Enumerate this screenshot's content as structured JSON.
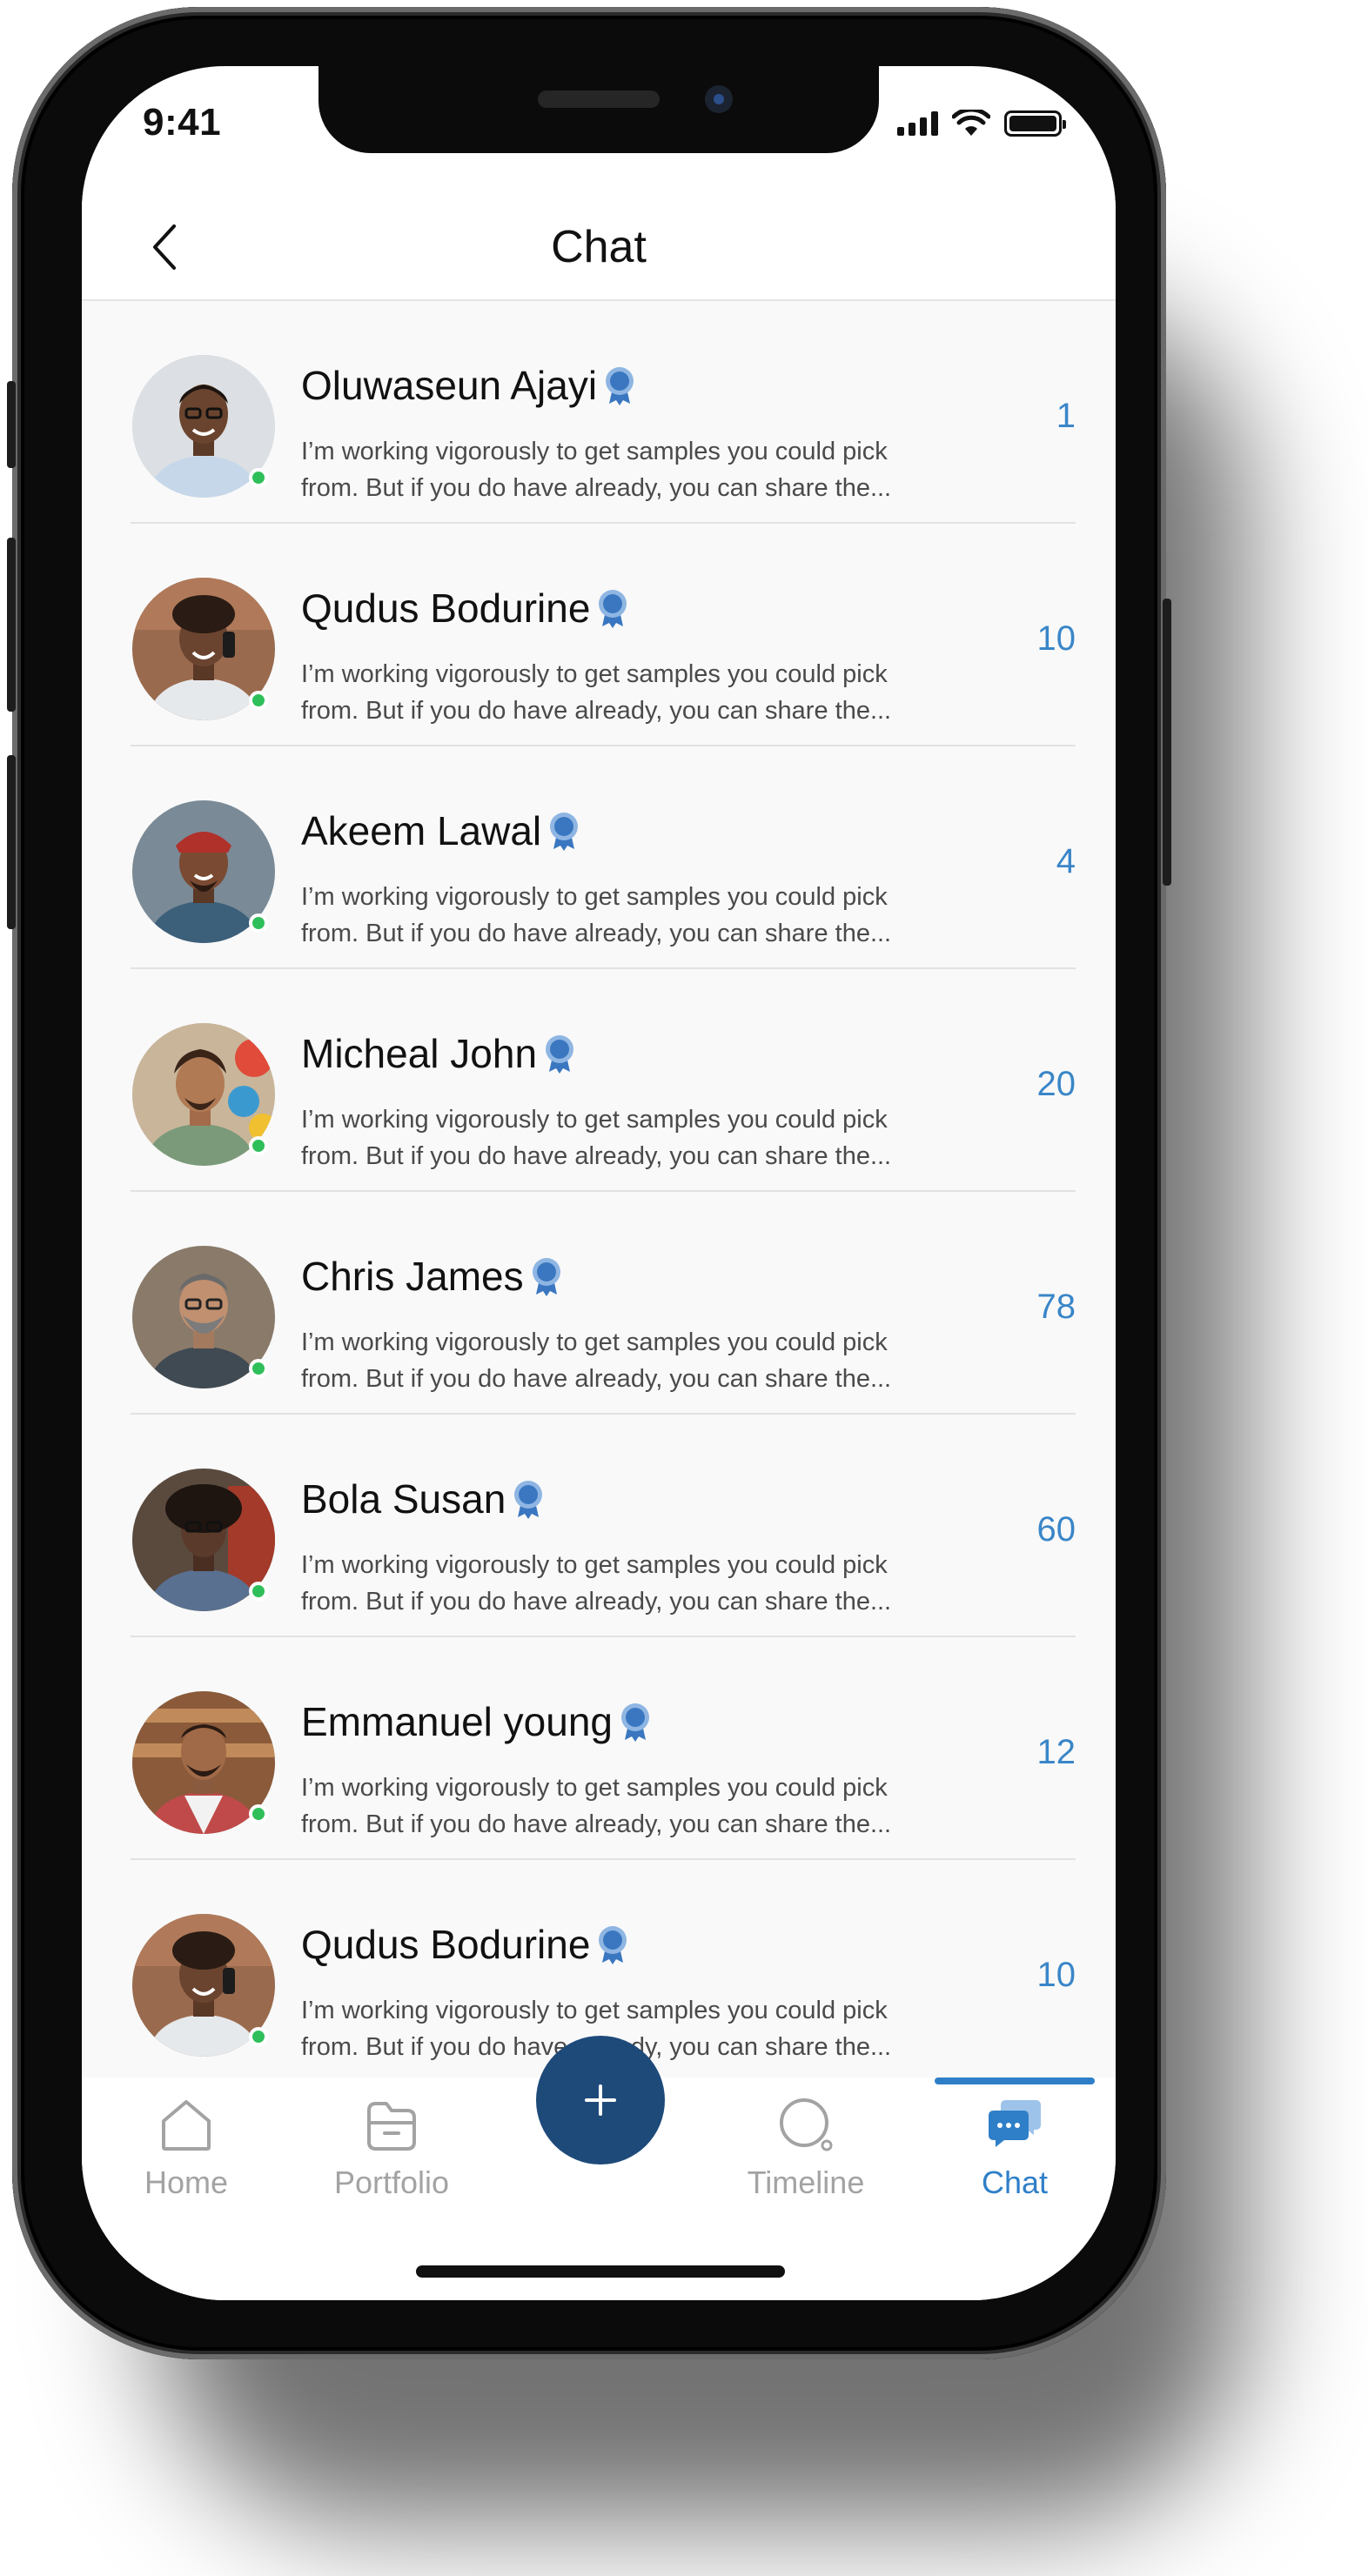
{
  "status_bar": {
    "time": "9:41"
  },
  "header": {
    "title": "Chat"
  },
  "colors": {
    "accent": "#2f7fc8",
    "fab": "#1e4a7a",
    "online": "#2fbf5a",
    "badge": "#3a77c0"
  },
  "chats": [
    {
      "name": "Oluwaseun Ajayi",
      "msg_line1": "I’m working vigorously to get samples you could pick",
      "msg_line2": "from. But if you do have already, you can share the...",
      "count": "1"
    },
    {
      "name": "Qudus Bodurine",
      "msg_line1": "I’m working vigorously to get samples you could pick",
      "msg_line2": "from. But if you do have already, you can share the...",
      "count": "10"
    },
    {
      "name": "Akeem Lawal",
      "msg_line1": "I’m working vigorously to get samples you could pick",
      "msg_line2": "from. But if you do have already, you can share the...",
      "count": "4"
    },
    {
      "name": "Micheal John",
      "msg_line1": "I’m working vigorously to get samples you could pick",
      "msg_line2": "from. But if you do have already, you can share the...",
      "count": "20"
    },
    {
      "name": "Chris James",
      "msg_line1": "I’m working vigorously to get samples you could pick",
      "msg_line2": "from. But if you do have already, you can share the...",
      "count": "78"
    },
    {
      "name": "Bola Susan",
      "msg_line1": "I’m working vigorously to get samples you could pick",
      "msg_line2": "from. But if you do have already, you can share the...",
      "count": "60"
    },
    {
      "name": "Emmanuel young",
      "msg_line1": "I’m working vigorously to get samples you could pick",
      "msg_line2": "from. But if you do have already, you can share the...",
      "count": "12"
    },
    {
      "name": "Qudus Bodurine",
      "msg_line1": "I’m working vigorously to get samples you could pick",
      "msg_line2": "from. But if you do have already, you can share the...",
      "count": "10"
    }
  ],
  "tabs": {
    "home": "Home",
    "portfolio": "Portfolio",
    "timeline": "Timeline",
    "chat": "Chat",
    "active": "chat"
  },
  "icons": [
    "back-icon",
    "verified-badge-icon",
    "home-icon",
    "portfolio-icon",
    "timeline-icon",
    "chat-icon",
    "plus-icon"
  ]
}
